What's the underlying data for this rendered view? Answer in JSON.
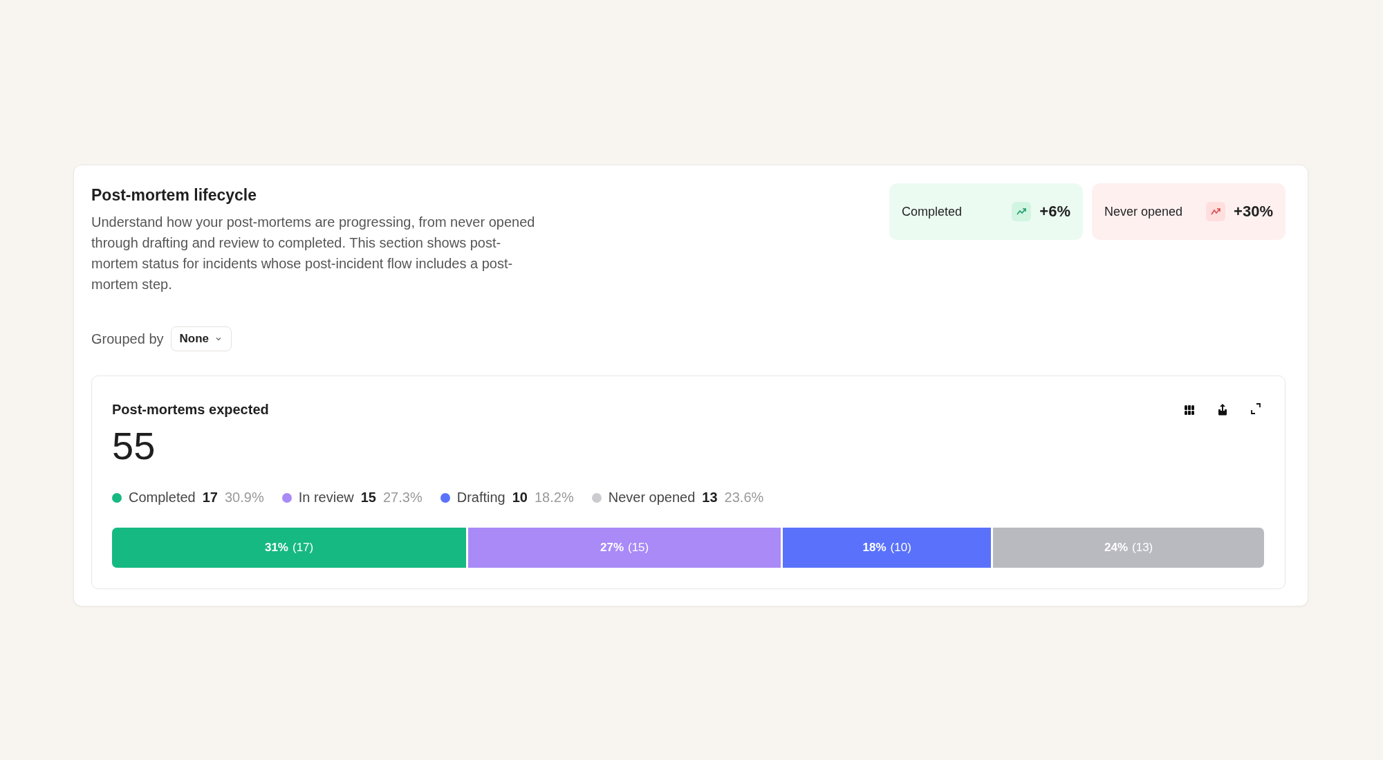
{
  "section": {
    "title": "Post-mortem lifecycle",
    "description": "Understand how your post-mortems are progressing, from never opened through drafting and review to completed. This section shows post-mortem status for incidents whose post-incident flow includes a post-mortem step."
  },
  "trends": [
    {
      "label": "Completed",
      "change": "+6%",
      "kind": "positive"
    },
    {
      "label": "Never opened",
      "change": "+30%",
      "kind": "negative"
    }
  ],
  "grouping": {
    "label": "Grouped by",
    "value": "None"
  },
  "panel": {
    "title": "Post-mortems expected",
    "total": "55",
    "legend": [
      {
        "name": "Completed",
        "count": "17",
        "percent": "30.9%",
        "color": "#16b981"
      },
      {
        "name": "In review",
        "count": "15",
        "percent": "27.3%",
        "color": "#a98af7"
      },
      {
        "name": "Drafting",
        "count": "10",
        "percent": "18.2%",
        "color": "#5a72fb"
      },
      {
        "name": "Never opened",
        "count": "13",
        "percent": "23.6%",
        "color": "#cbcbd0"
      }
    ],
    "segments": [
      {
        "percent": "31%",
        "count": "(17)",
        "color": "#16b981"
      },
      {
        "percent": "27%",
        "count": "(15)",
        "color": "#a98af7"
      },
      {
        "percent": "18%",
        "count": "(10)",
        "color": "#5a72fb"
      },
      {
        "percent": "24%",
        "count": "(13)",
        "color": "#b9b9c0"
      }
    ]
  }
}
